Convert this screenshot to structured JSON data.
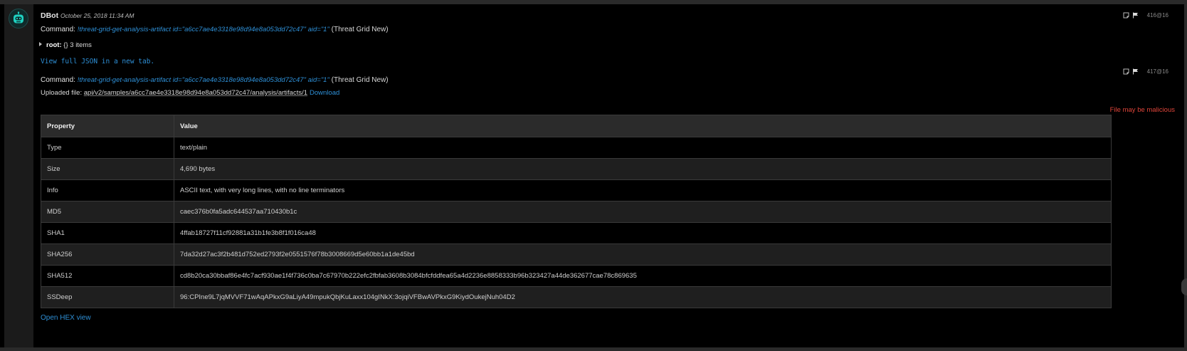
{
  "entry": {
    "bot_name": "DBot",
    "timestamp": "October 25, 2018 11:34 AM"
  },
  "command1": {
    "label": "Command:",
    "text": "!threat-grid-get-analysis-artifact id=\"a6cc7ae4e3318e98d94e8a053dd72c47\" aid=\"1\"",
    "integration": "(Threat Grid New)",
    "entry_id": "416@16"
  },
  "json_tree": {
    "root_key": "root:",
    "summary": "{} 3 items"
  },
  "view_json_link": "View full JSON in a new tab.",
  "command2": {
    "label": "Command:",
    "text": "!threat-grid-get-analysis-artifact id=\"a6cc7ae4e3318e98d94e8a053dd72c47\" aid=\"1\"",
    "integration": "(Threat Grid New)",
    "entry_id": "417@16"
  },
  "upload": {
    "label": "Uploaded file:",
    "path": "api/v2/samples/a6cc7ae4e3318e98d94e8a053dd72c47/analysis/artifacts/1",
    "download": "Download"
  },
  "warning": "File may be malicious",
  "table": {
    "headers": [
      "Property",
      "Value"
    ],
    "rows": [
      [
        "Type",
        "text/plain"
      ],
      [
        "Size",
        "4,690 bytes"
      ],
      [
        "Info",
        "ASCII text, with very long lines, with no line terminators"
      ],
      [
        "MD5",
        "caec376b0fa5adc644537aa710430b1c"
      ],
      [
        "SHA1",
        "4ffab18727f11cf92881a31b1fe3b8f1f016ca48"
      ],
      [
        "SHA256",
        "7da32d27ac3f2b481d752ed2793f2e0551576f78b3008669d5e60bb1a1de45bd"
      ],
      [
        "SHA512",
        "cd8b20ca30bbaf86e4fc7acf930ae1f4f736c0ba7c67970b222efc2fbfab3608b3084bfcfddfea65a4d2236e8858333b96b323427a44de362677cae78c869635"
      ],
      [
        "SSDeep",
        "96:CPIne9L7jqMVVF71wAqAPkxG9aLiyA49mpukQbjKuLaxx104gINkX:3ojqiVFBwAVPkxG9KiydOukejNuh04D2"
      ]
    ]
  },
  "hex_link": "Open HEX view",
  "colors": {
    "accent": "#2e8fd6",
    "warning": "#e0453a",
    "avatar": "#1fd1c1"
  },
  "icons": [
    "robot-avatar-icon",
    "note-icon",
    "flag-icon",
    "caret-right-icon"
  ]
}
